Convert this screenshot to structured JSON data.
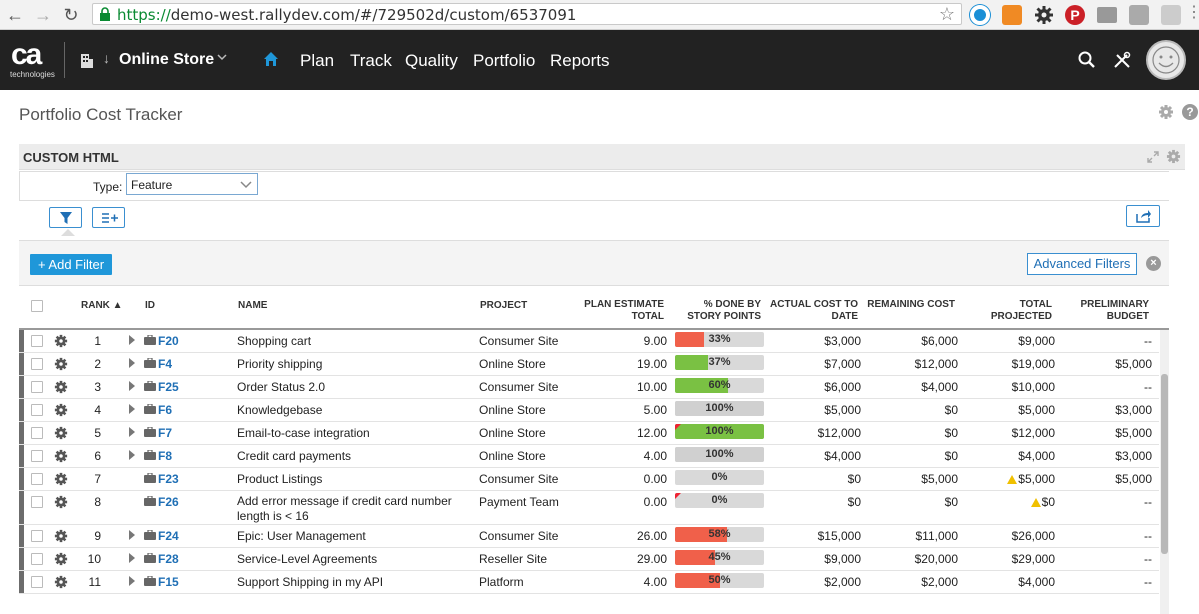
{
  "browser": {
    "url_scheme": "https://",
    "url_rest": "demo-west.rallydev.com/#/729502d/custom/6537091"
  },
  "header": {
    "logo_text": "ca",
    "logo_sub": "technologies",
    "project": "Online Store",
    "menu": [
      "Plan",
      "Track",
      "Quality",
      "Portfolio",
      "Reports"
    ]
  },
  "page": {
    "title": "Portfolio Cost Tracker"
  },
  "panel": {
    "title": "CUSTOM HTML",
    "type_label": "Type:",
    "type_value": "Feature",
    "add_filter": "+ Add Filter",
    "advanced_filters": "Advanced Filters"
  },
  "table": {
    "columns": {
      "rank": "RANK",
      "id": "ID",
      "name": "NAME",
      "project": "PROJECT",
      "plan_estimate": [
        "PLAN ESTIMATE",
        "TOTAL"
      ],
      "pct_done": [
        "% DONE BY",
        "STORY POINTS"
      ],
      "actual_cost": [
        "ACTUAL COST TO",
        "DATE"
      ],
      "remaining": "REMAINING COST",
      "total_projected": [
        "TOTAL",
        "PROJECTED"
      ],
      "prelim_budget": [
        "PRELIMINARY",
        "BUDGET"
      ]
    },
    "rows": [
      {
        "rank": "1",
        "id": "F20",
        "name": "Shopping cart",
        "project": "Consumer Site",
        "estimate": "9.00",
        "pct": "33%",
        "pct_val": 0.33,
        "bar_color": "#f0604a",
        "actual": "$3,000",
        "remaining": "$6,000",
        "total": "$9,000",
        "budget": "--",
        "expander": true,
        "warn": false
      },
      {
        "rank": "2",
        "id": "F4",
        "name": "Priority shipping",
        "project": "Online Store",
        "estimate": "19.00",
        "pct": "37%",
        "pct_val": 0.37,
        "bar_color": "#7ac143",
        "actual": "$7,000",
        "remaining": "$12,000",
        "total": "$19,000",
        "budget": "$5,000",
        "expander": true,
        "warn": false
      },
      {
        "rank": "3",
        "id": "F25",
        "name": "Order Status 2.0",
        "project": "Consumer Site",
        "estimate": "10.00",
        "pct": "60%",
        "pct_val": 0.6,
        "bar_color": "#7ac143",
        "actual": "$6,000",
        "remaining": "$4,000",
        "total": "$10,000",
        "budget": "--",
        "expander": true,
        "warn": false
      },
      {
        "rank": "4",
        "id": "F6",
        "name": "Knowledgebase",
        "project": "Online Store",
        "estimate": "5.00",
        "pct": "100%",
        "pct_val": 1.0,
        "bar_color": "#d0d0d0",
        "actual": "$5,000",
        "remaining": "$0",
        "total": "$5,000",
        "budget": "$3,000",
        "expander": true,
        "warn": false
      },
      {
        "rank": "5",
        "id": "F7",
        "name": "Email-to-case integration",
        "project": "Online Store",
        "estimate": "12.00",
        "pct": "100%",
        "pct_val": 1.0,
        "bar_color": "#7ac143",
        "actual": "$12,000",
        "remaining": "$0",
        "total": "$12,000",
        "budget": "$5,000",
        "expander": true,
        "warn": false,
        "flag": true
      },
      {
        "rank": "6",
        "id": "F8",
        "name": "Credit card payments",
        "project": "Online Store",
        "estimate": "4.00",
        "pct": "100%",
        "pct_val": 1.0,
        "bar_color": "#d0d0d0",
        "actual": "$4,000",
        "remaining": "$0",
        "total": "$4,000",
        "budget": "$3,000",
        "expander": true,
        "warn": false
      },
      {
        "rank": "7",
        "id": "F23",
        "name": "Product Listings",
        "project": "Consumer Site",
        "estimate": "0.00",
        "pct": "0%",
        "pct_val": 0,
        "bar_color": "#d9d9d9",
        "actual": "$0",
        "remaining": "$5,000",
        "total": "$5,000",
        "budget": "$5,000",
        "expander": false,
        "warn": true
      },
      {
        "rank": "8",
        "id": "F26",
        "name": "Add error message if credit card number length is < 16",
        "project": "Payment Team",
        "estimate": "0.00",
        "pct": "0%",
        "pct_val": 0,
        "bar_color": "#d9d9d9",
        "actual": "$0",
        "remaining": "$0",
        "total": "$0",
        "budget": "--",
        "expander": false,
        "warn": true,
        "flag": true
      },
      {
        "rank": "9",
        "id": "F24",
        "name": "Epic: User Management",
        "project": "Consumer Site",
        "estimate": "26.00",
        "pct": "58%",
        "pct_val": 0.58,
        "bar_color": "#f0604a",
        "actual": "$15,000",
        "remaining": "$11,000",
        "total": "$26,000",
        "budget": "--",
        "expander": true,
        "warn": false
      },
      {
        "rank": "10",
        "id": "F28",
        "name": "Service-Level Agreements",
        "project": "Reseller Site",
        "estimate": "29.00",
        "pct": "45%",
        "pct_val": 0.45,
        "bar_color": "#f0604a",
        "actual": "$9,000",
        "remaining": "$20,000",
        "total": "$29,000",
        "budget": "--",
        "expander": true,
        "warn": false
      },
      {
        "rank": "11",
        "id": "F15",
        "name": "Support Shipping in my API",
        "project": "Platform",
        "estimate": "4.00",
        "pct": "50%",
        "pct_val": 0.5,
        "bar_color": "#f0604a",
        "actual": "$2,000",
        "remaining": "$2,000",
        "total": "$4,000",
        "budget": "--",
        "expander": true,
        "warn": false
      }
    ]
  }
}
